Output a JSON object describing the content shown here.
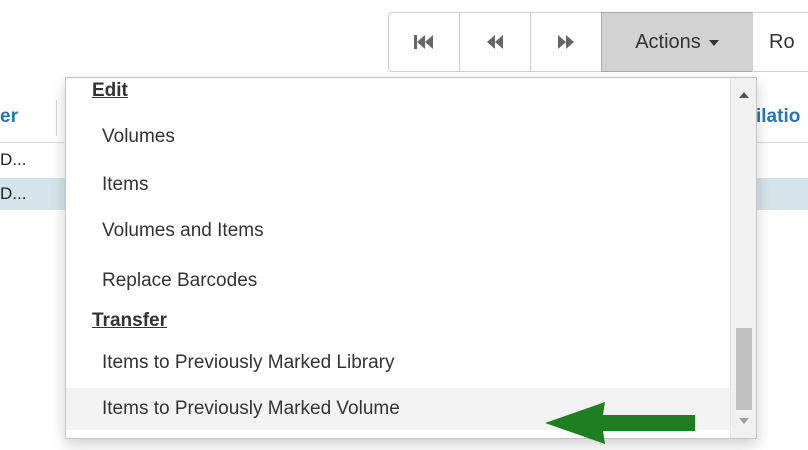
{
  "toolbar": {
    "first_page_icon": "first-page-icon",
    "prev_page_icon": "previous-page-icon",
    "next_page_icon": "next-page-icon",
    "actions_label": "Actions",
    "next_button_partial": "Ro"
  },
  "grid": {
    "left_header_partial": "er",
    "right_header_partial": "ilatio",
    "rows": [
      {
        "cell_partial": "D..."
      },
      {
        "cell_partial": "D..."
      }
    ],
    "selected_row_color": "#d5e4ea"
  },
  "dropdown": {
    "sections": [
      {
        "header": "Edit",
        "items": [
          {
            "label": "Volumes"
          },
          {
            "label": "Items"
          },
          {
            "label": "Volumes and Items"
          },
          {
            "label": "Replace Barcodes"
          }
        ]
      },
      {
        "header": "Transfer",
        "items": [
          {
            "label": "Items to Previously Marked Library"
          },
          {
            "label": "Items to Previously Marked Volume"
          }
        ]
      }
    ],
    "highlighted_item": "Items to Previously Marked Volume"
  },
  "annotation": {
    "icon": "green-arrow-left",
    "color": "#1e7f22"
  },
  "colors": {
    "header_link": "#2a75ad",
    "actions_button_bg": "#d2d2d2"
  }
}
